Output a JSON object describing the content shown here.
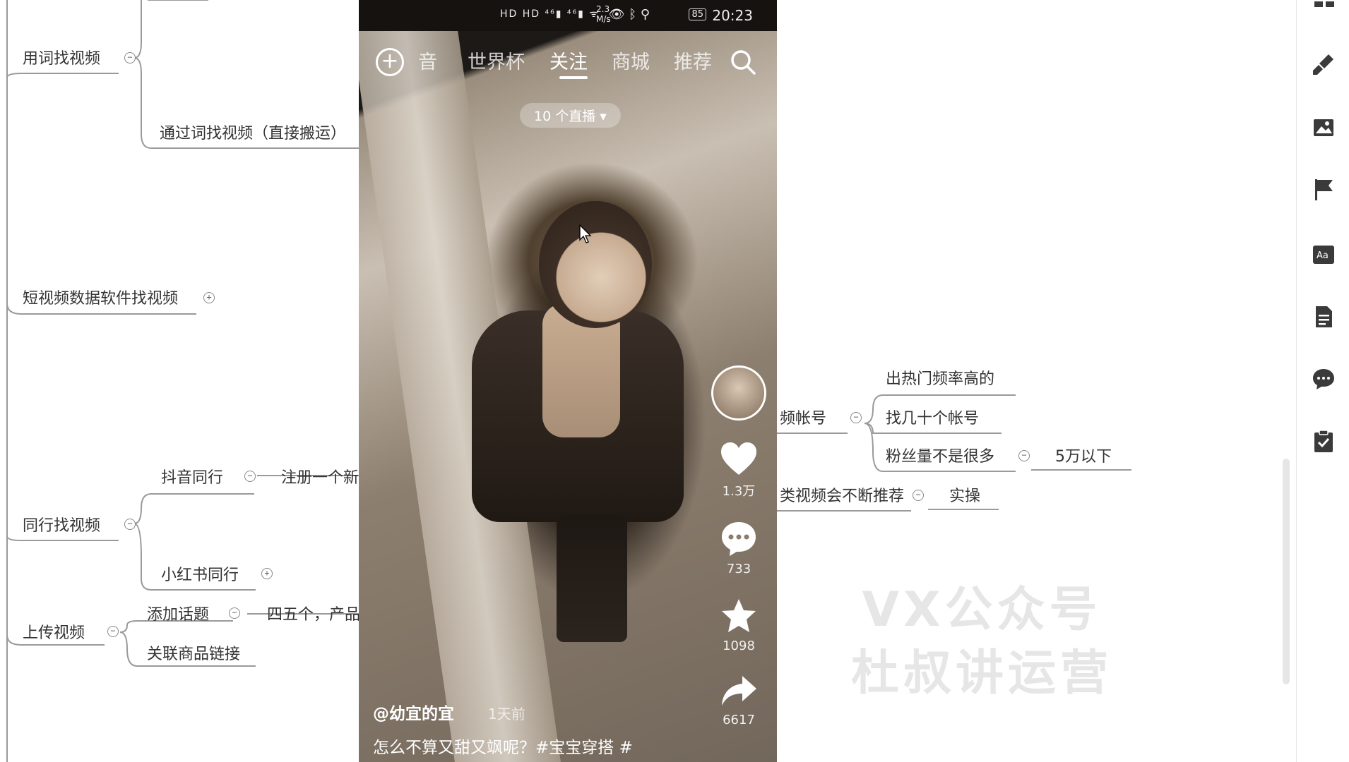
{
  "mindmap": {
    "word_find": "用词找视频",
    "word_find_direct": "通过词找视频（直接搬运）",
    "data_software": "短视频数据软件找视频",
    "peer_find": "同行找视频",
    "douyin_peer": "抖音同行",
    "register_new": "注册一个新",
    "xhs_peer": "小红书同行",
    "upload": "上传视频",
    "add_topic": "添加话题",
    "four_five": "四五个，产品",
    "link_product": "关联商品链接",
    "account_cut": "频帐号",
    "hot_rate": "出热门频率高的",
    "find_accounts": "找几十个帐号",
    "fans_not_many": "粉丝量不是很多",
    "under_50k": "5万以下",
    "keep_recommend": "类视频会不断推荐",
    "practice": "实操"
  },
  "phone": {
    "status": {
      "time": "20:23",
      "battery": "85",
      "speed": "2.3 M/s",
      "left_icons": "HD HD ⁴⁶▮ ⁴⁶▮ ᯤ"
    },
    "tabs": {
      "cut": "音",
      "worldcup": "世界杯",
      "follow": "关注",
      "mall": "商城",
      "recommend": "推荐"
    },
    "live_pill": "10 个直播 ▾",
    "actions": {
      "likes": "1.3万",
      "comments": "733",
      "favorites": "1098",
      "shares": "6617"
    },
    "author": "@幼宜的宜",
    "time_ago": "1天前",
    "caption": "怎么不算又甜又飒呢？#宝宝穿搭 #"
  },
  "watermark": {
    "line1": "VX公众号",
    "line2": "杜叔讲运营"
  },
  "icons": {
    "right_bar": [
      "layout-icon",
      "brush-icon",
      "image-icon",
      "flag-icon",
      "text-style-icon",
      "document-icon",
      "comment-icon",
      "clipboard-check-icon"
    ]
  }
}
